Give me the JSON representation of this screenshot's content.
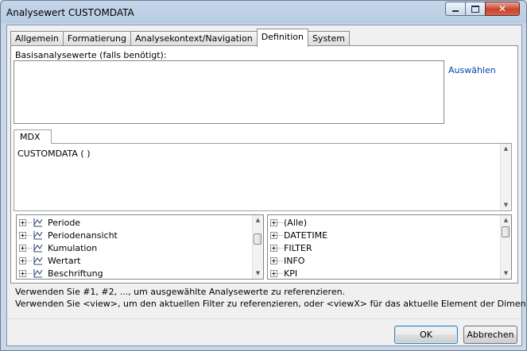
{
  "window": {
    "title": "Analysewert CUSTOMDATA"
  },
  "tabs": [
    {
      "label": "Allgemein"
    },
    {
      "label": "Formatierung"
    },
    {
      "label": "Analysekontext/Navigation"
    },
    {
      "label": "Definition"
    },
    {
      "label": "System"
    }
  ],
  "active_tab": "Definition",
  "basis": {
    "label": "Basisanalysewerte (falls benötigt):",
    "value": "",
    "select_link": "Auswählen"
  },
  "mdx": {
    "tab_label": "MDX",
    "expression": "CUSTOMDATA ( )"
  },
  "dimensions": [
    {
      "label": "Periode"
    },
    {
      "label": "Periodenansicht"
    },
    {
      "label": "Kumulation"
    },
    {
      "label": "Wertart"
    },
    {
      "label": "Beschriftung"
    }
  ],
  "functions": [
    {
      "label": "(Alle)"
    },
    {
      "label": "DATETIME"
    },
    {
      "label": "FILTER"
    },
    {
      "label": "INFO"
    },
    {
      "label": "KPI"
    }
  ],
  "info": {
    "line1": "Verwenden Sie #1, #2, ..., um ausgewählte Analysewerte zu referenzieren.",
    "line2": "Verwenden Sie <view>, um den aktuellen Filter zu referenzieren, oder <viewX> für das aktuelle Element der Dimension X."
  },
  "buttons": {
    "ok": "OK",
    "cancel": "Abbrechen"
  }
}
